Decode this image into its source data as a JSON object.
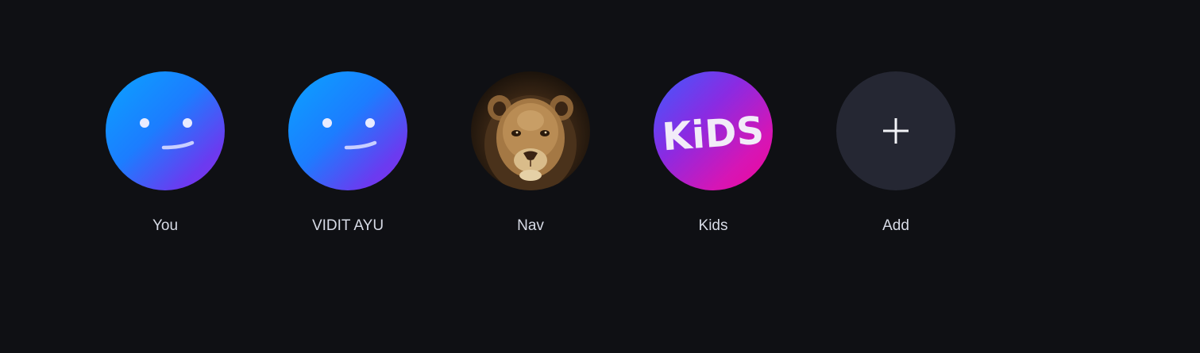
{
  "profiles": [
    {
      "name": "You",
      "avatar": "smile-face-icon"
    },
    {
      "name": "VIDIT AYU",
      "avatar": "smile-face-icon"
    },
    {
      "name": "Nav",
      "avatar": "lion-cub-image"
    },
    {
      "name": "Kids",
      "avatar": "kids-logo",
      "logo_text": "KiDS"
    },
    {
      "name": "Add",
      "avatar": "plus-icon"
    }
  ],
  "colors": {
    "background": "#0f1014",
    "label": "#d7dbe6",
    "add_circle": "#252733",
    "smile_gradient_start": "#0aa3ff",
    "smile_gradient_end": "#8a2de8",
    "kids_gradient_start": "#3d5bff",
    "kids_gradient_end": "#f0079a"
  }
}
